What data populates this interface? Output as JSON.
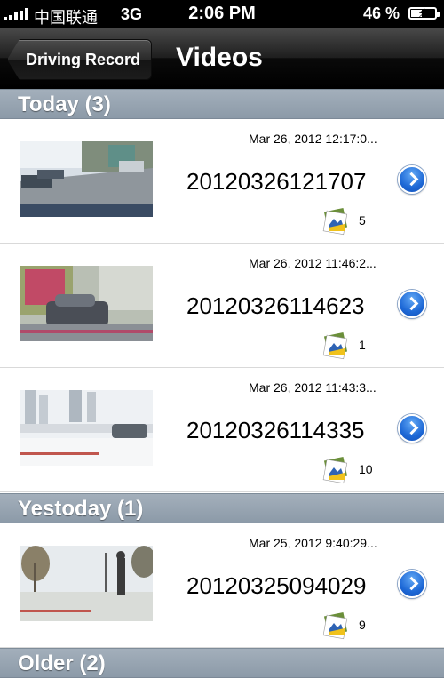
{
  "status_bar": {
    "carrier": "中国联通",
    "network": "3G",
    "time": "2:06 PM",
    "battery_percent": "46 %",
    "battery_level": 0.46
  },
  "nav": {
    "back_label": "Driving Record",
    "title": "Videos"
  },
  "sections": [
    {
      "header": "Today (3)",
      "rows": [
        {
          "timestamp": "Mar 26, 2012 12:17:0...",
          "name": "20120326121707",
          "count": "5"
        },
        {
          "timestamp": "Mar 26, 2012 11:46:2...",
          "name": "20120326114623",
          "count": "1"
        },
        {
          "timestamp": "Mar 26, 2012 11:43:3...",
          "name": "20120326114335",
          "count": "10"
        }
      ]
    },
    {
      "header": "Yestoday (1)",
      "rows": [
        {
          "timestamp": "Mar 25, 2012 9:40:29...",
          "name": "20120325094029",
          "count": "9"
        }
      ]
    },
    {
      "header": "Older (2)",
      "rows": []
    }
  ],
  "colors": {
    "section_header": "#98a6b4",
    "disclosure_blue": "#1d68d6",
    "navbar": "#000000"
  },
  "icons": {
    "row_photos": "photos-stack-icon",
    "row_disclosure": "chevron-right-circle-icon"
  }
}
